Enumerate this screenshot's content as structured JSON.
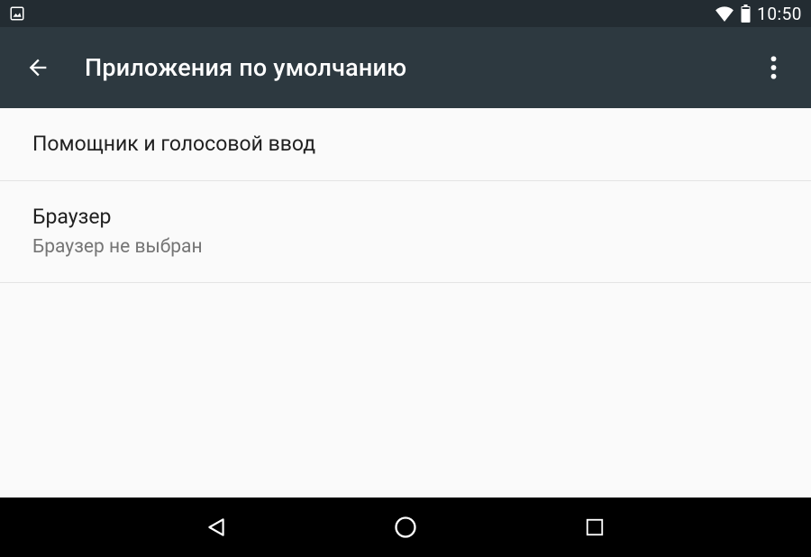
{
  "statusBar": {
    "time": "10:50"
  },
  "appBar": {
    "title": "Приложения по умолчанию"
  },
  "list": {
    "items": [
      {
        "title": "Помощник и голосовой ввод",
        "subtitle": ""
      },
      {
        "title": "Браузер",
        "subtitle": "Браузер не выбран"
      }
    ]
  }
}
